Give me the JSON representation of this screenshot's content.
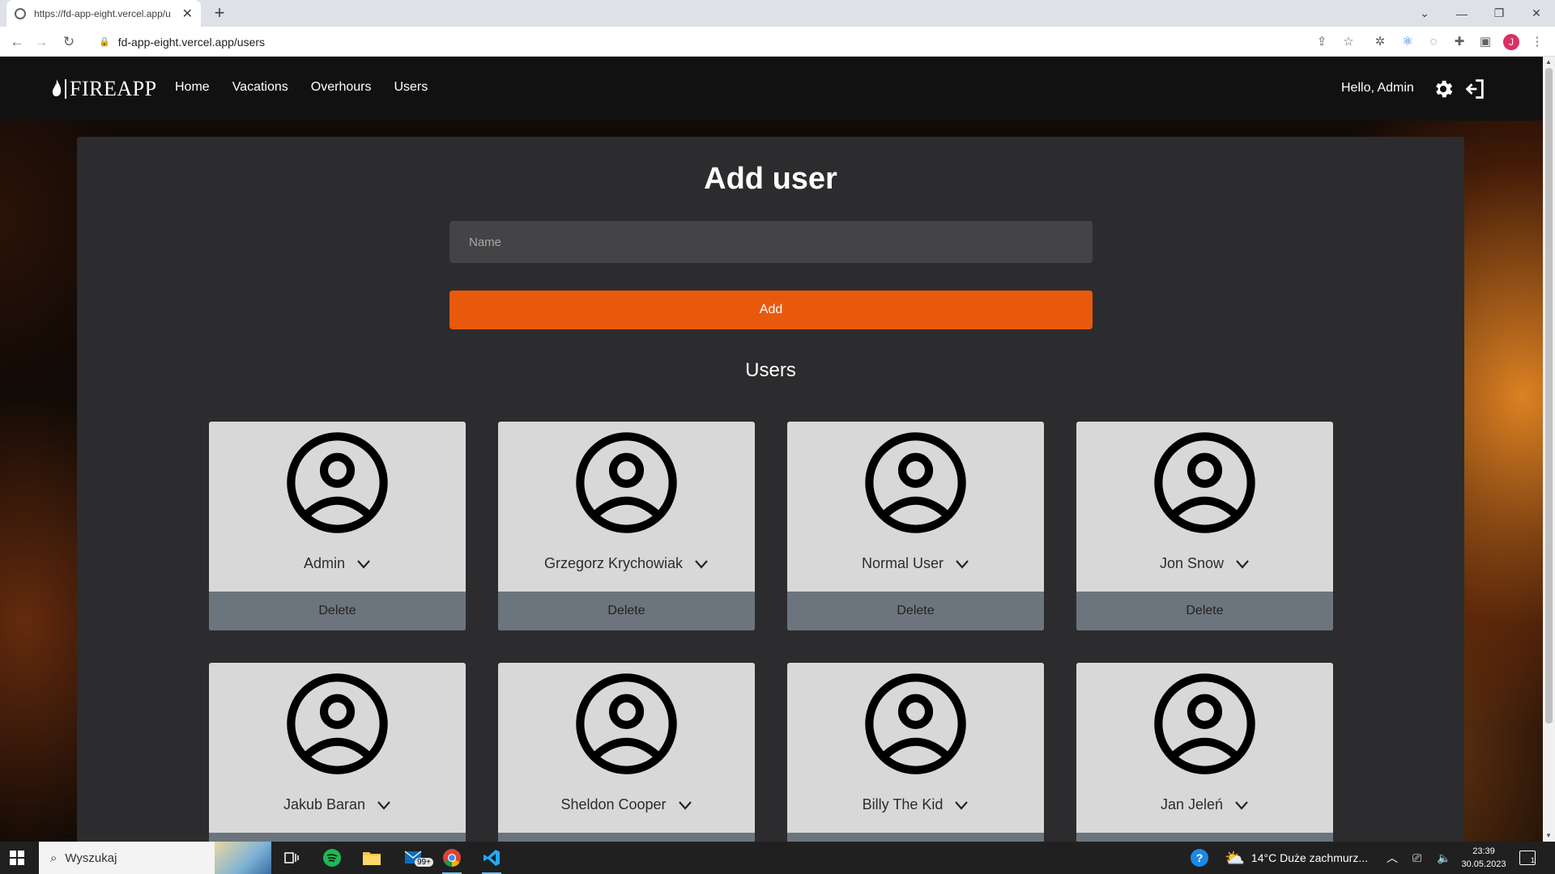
{
  "browser": {
    "tab_title": "https://fd-app-eight.vercel.app/u",
    "url": "fd-app-eight.vercel.app/users",
    "profile_initial": "J"
  },
  "nav": {
    "logo": "FIREAPP",
    "links": [
      "Home",
      "Vacations",
      "Overhours",
      "Users"
    ],
    "greeting": "Hello, Admin"
  },
  "form": {
    "title": "Add user",
    "name_placeholder": "Name",
    "add_label": "Add"
  },
  "users_section": {
    "heading": "Users",
    "delete_label": "Delete",
    "users": [
      {
        "name": "Admin"
      },
      {
        "name": "Grzegorz Krychowiak"
      },
      {
        "name": "Normal User"
      },
      {
        "name": "Jon Snow"
      },
      {
        "name": "Jakub Baran"
      },
      {
        "name": "Sheldon Cooper"
      },
      {
        "name": "Billy The Kid"
      },
      {
        "name": "Jan Jeleń"
      }
    ]
  },
  "taskbar": {
    "search_label": "Wyszukaj",
    "mail_badge": "99+",
    "weather": "14°C  Duże zachmurz...",
    "time": "23:39",
    "date": "30.05.2023",
    "notification_count": "1"
  },
  "colors": {
    "accent": "#e8590c",
    "panel": "#2c2c2e",
    "card": "#d8d8d8",
    "delete_bar": "#6c757d"
  }
}
